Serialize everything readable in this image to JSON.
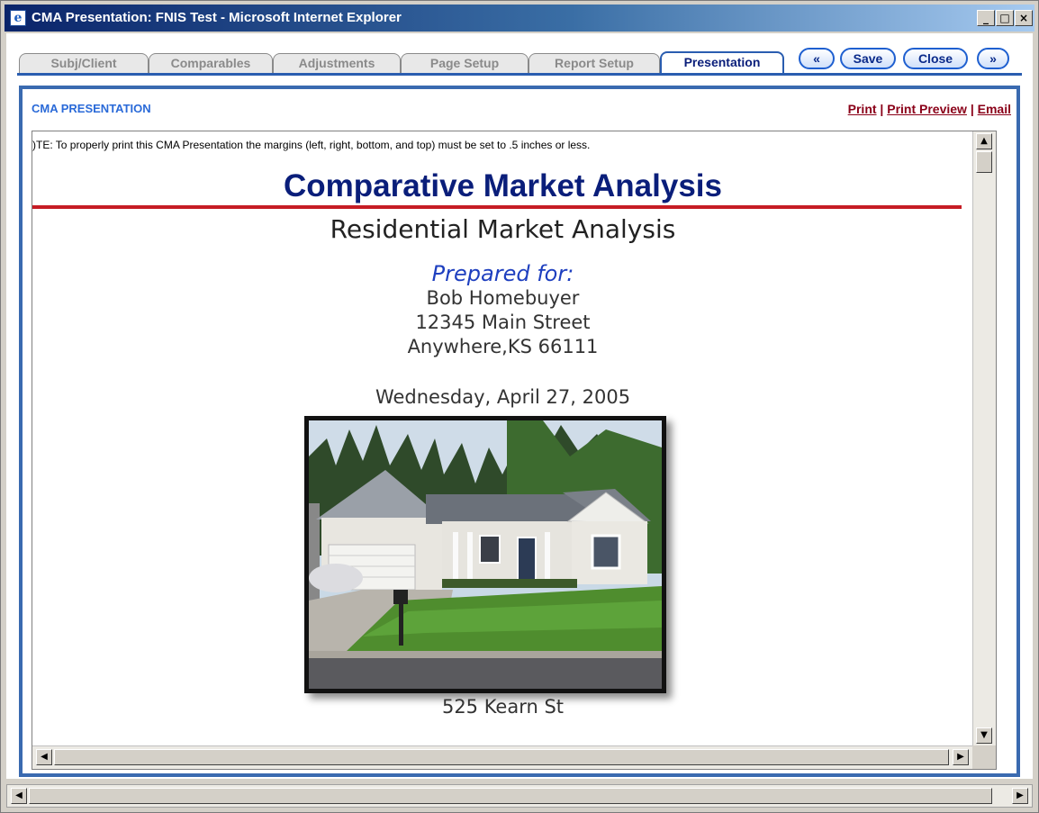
{
  "window": {
    "title": "CMA Presentation: FNIS Test - Microsoft Internet Explorer",
    "app_icon": "ie-icon",
    "controls": {
      "minimize": "_",
      "maximize": "□",
      "close": "×"
    }
  },
  "tabs": [
    {
      "label": "Subj/Client",
      "active": false
    },
    {
      "label": "Comparables",
      "active": false
    },
    {
      "label": "Adjustments",
      "active": false
    },
    {
      "label": "Page Setup",
      "active": false
    },
    {
      "label": "Report Setup",
      "active": false
    },
    {
      "label": "Presentation",
      "active": true
    }
  ],
  "nav_buttons": {
    "prev": "«",
    "save": "Save",
    "close": "Close",
    "next": "»"
  },
  "panel": {
    "header": "CMA PRESENTATION",
    "links": {
      "print": "Print",
      "print_preview": "Print Preview",
      "email": "Email",
      "separator": " | "
    }
  },
  "document": {
    "note": ")TE: To properly print this CMA Presentation the margins (left, right, bottom, and top) must be set to .5 inches or less.",
    "title": "Comparative Market Analysis",
    "subtitle": "Residential Market Analysis",
    "prepared_label": "Prepared for:",
    "client_name": "Bob Homebuyer",
    "street": "12345 Main Street",
    "city_state_zip": "Anywhere,KS 66111",
    "date": "Wednesday, April 27, 2005",
    "photo_caption": "525 Kearn St"
  },
  "colors": {
    "title_blue": "#0a1e7a",
    "rule_red": "#c61c24",
    "link_maroon": "#8a0018",
    "header_blue": "#2a6ad8",
    "panel_border": "#3a6ab0"
  }
}
